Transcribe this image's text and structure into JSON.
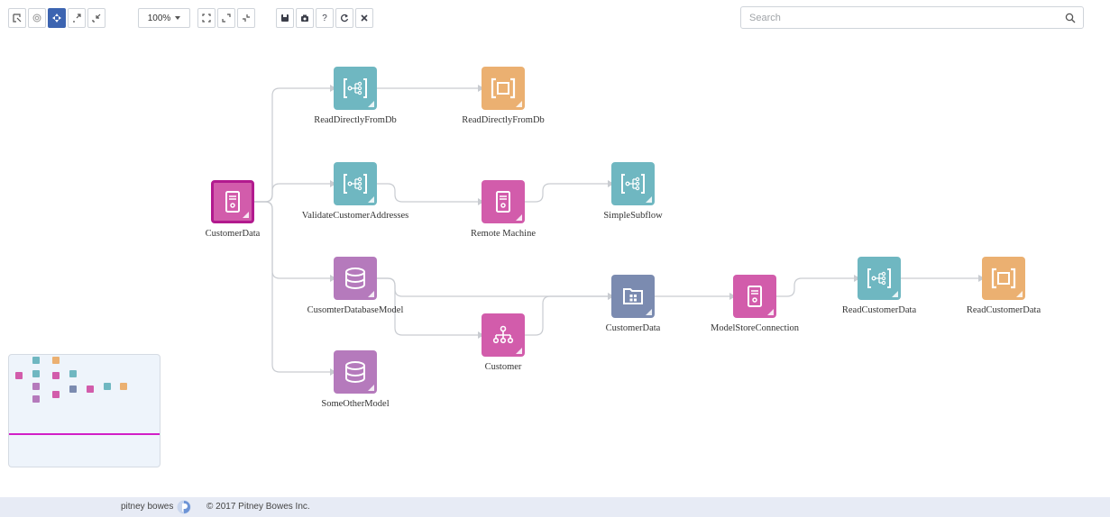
{
  "toolbar": {
    "buttons_left": [
      {
        "name": "select-button",
        "icon": "select-icon"
      },
      {
        "name": "target-button",
        "icon": "target-icon"
      },
      {
        "name": "pan-button",
        "icon": "pan-icon",
        "active": true
      },
      {
        "name": "expand-button",
        "icon": "expand-icon"
      },
      {
        "name": "collapse-button",
        "icon": "collapse-icon"
      }
    ],
    "zoom_label": "100%",
    "buttons_mid": [
      {
        "name": "fit-button",
        "icon": "fit-icon"
      },
      {
        "name": "zoom-in-button",
        "icon": "zoom-in-icon"
      },
      {
        "name": "zoom-out-button",
        "icon": "zoom-out-icon"
      }
    ],
    "buttons_right": [
      {
        "name": "save-button",
        "icon": "save-icon",
        "text": ""
      },
      {
        "name": "camera-button",
        "icon": "camera-icon",
        "text": ""
      },
      {
        "name": "help-button",
        "icon": "help-icon",
        "text": "?"
      },
      {
        "name": "refresh-button",
        "icon": "refresh-icon",
        "text": ""
      },
      {
        "name": "close-button",
        "icon": "close-icon",
        "text": ""
      }
    ]
  },
  "search": {
    "placeholder": "Search",
    "value": ""
  },
  "colors": {
    "teal": "#6fb7c1",
    "orange": "#ebb071",
    "magenta": "#d25cab",
    "purple": "#b57abc",
    "slate": "#7b8bb0",
    "selected_border": "#b21a8e",
    "toolbar_active": "#3c64b1"
  },
  "nodes": [
    {
      "id": "n1",
      "label": "CustomerData",
      "icon": "server-icon",
      "color": "magenta",
      "selected": true
    },
    {
      "id": "n2",
      "label": "ReadDirectlyFromDb",
      "icon": "subflow-icon",
      "color": "teal"
    },
    {
      "id": "n3",
      "label": "ReadDirectlyFromDb",
      "icon": "bracket-icon",
      "color": "orange"
    },
    {
      "id": "n4",
      "label": "ValidateCustomerAddresses",
      "icon": "subflow-icon",
      "color": "teal"
    },
    {
      "id": "n5",
      "label": "Remote Machine",
      "icon": "server-icon",
      "color": "magenta"
    },
    {
      "id": "n6",
      "label": "SimpleSubflow",
      "icon": "subflow-icon",
      "color": "teal"
    },
    {
      "id": "n7",
      "label": "CusomterDatabaseModel",
      "icon": "database-icon",
      "color": "purple"
    },
    {
      "id": "n8",
      "label": "Customer",
      "icon": "hierarchy-icon",
      "color": "magenta"
    },
    {
      "id": "n9",
      "label": "CustomerData",
      "icon": "folder-icon",
      "color": "slate"
    },
    {
      "id": "n10",
      "label": "ModelStoreConnection",
      "icon": "server-icon",
      "color": "magenta"
    },
    {
      "id": "n11",
      "label": "ReadCustomerData",
      "icon": "subflow-icon",
      "color": "teal"
    },
    {
      "id": "n12",
      "label": "ReadCustomerData",
      "icon": "bracket-icon",
      "color": "orange"
    },
    {
      "id": "n13",
      "label": "SomeOtherModel",
      "icon": "database-icon",
      "color": "purple"
    }
  ],
  "edges": [
    [
      "n1",
      "n2"
    ],
    [
      "n1",
      "n4"
    ],
    [
      "n1",
      "n7"
    ],
    [
      "n1",
      "n13"
    ],
    [
      "n2",
      "n3"
    ],
    [
      "n4",
      "n5"
    ],
    [
      "n5",
      "n6"
    ],
    [
      "n7",
      "n9"
    ],
    [
      "n7",
      "n8"
    ],
    [
      "n8",
      "n9"
    ],
    [
      "n9",
      "n10"
    ],
    [
      "n10",
      "n11"
    ],
    [
      "n11",
      "n12"
    ]
  ],
  "footer": {
    "brand": "pitney bowes",
    "brand_icon": "pitney-bowes-logo-icon",
    "copyright": "© 2017 Pitney Bowes Inc."
  }
}
